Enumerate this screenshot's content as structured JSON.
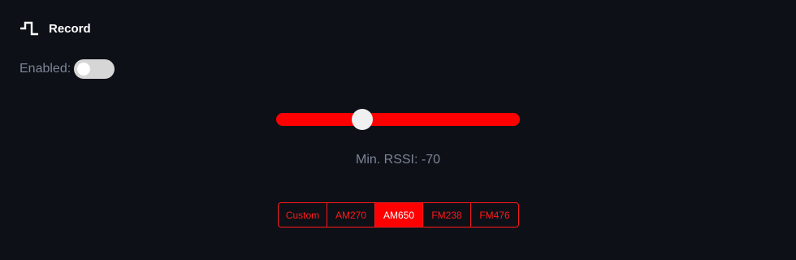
{
  "header": {
    "title": "Record",
    "icon": "square-wave-icon"
  },
  "enabled": {
    "label": "Enabled:",
    "value": false
  },
  "rssi": {
    "label": "Min. RSSI: -70",
    "value": -70,
    "min": -100,
    "max": -15
  },
  "presets": {
    "items": [
      "Custom",
      "AM270",
      "AM650",
      "FM238",
      "FM476"
    ],
    "selected": "AM650"
  },
  "colors": {
    "accent": "#ff0000",
    "background": "#0d1017",
    "muted_text": "#7c8496"
  }
}
